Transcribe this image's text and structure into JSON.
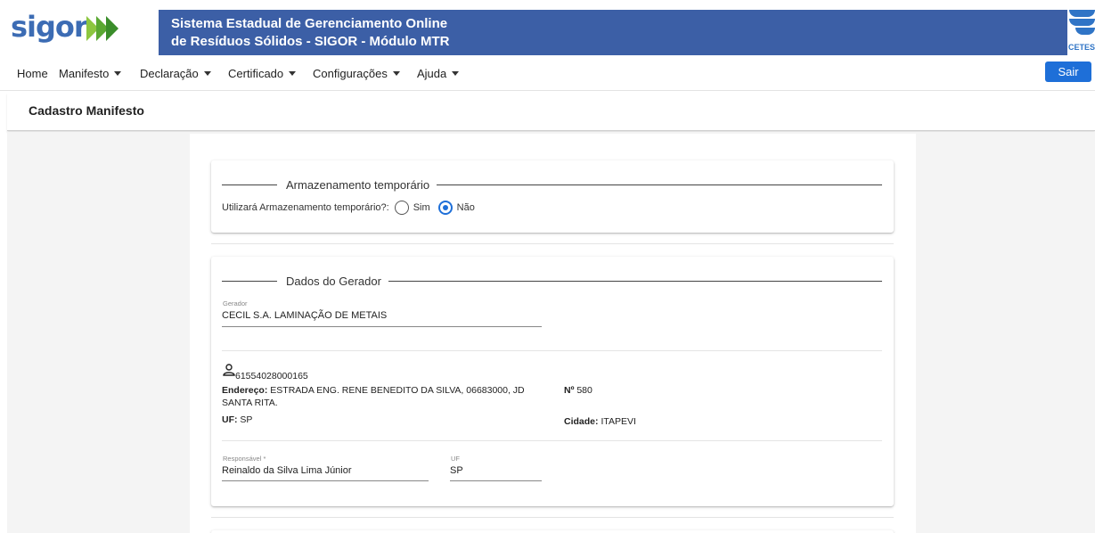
{
  "header": {
    "logo_text": "sigor",
    "title_line1": "Sistema Estadual de Gerenciamento Online",
    "title_line2": "de Resíduos Sólidos - SIGOR - Módulo MTR",
    "cetesb_label": "CETES",
    "brand_blue": "#3c5fa6",
    "accent_green": "#5aa832"
  },
  "nav": {
    "items": [
      {
        "label": "Home",
        "dropdown": false
      },
      {
        "label": "Manifesto",
        "dropdown": true
      },
      {
        "label": "Declaração",
        "dropdown": true
      },
      {
        "label": "Certificado",
        "dropdown": true
      },
      {
        "label": "Configurações",
        "dropdown": true
      },
      {
        "label": "Ajuda",
        "dropdown": true
      }
    ],
    "logout_label": "Sair"
  },
  "page": {
    "title": "Cadastro Manifesto"
  },
  "armazenamento": {
    "legend": "Armazenamento temporário",
    "question": "Utilizará Armazenamento temporário?:",
    "options": [
      "Sim",
      "Não"
    ],
    "selected": "Não"
  },
  "gerador": {
    "legend": "Dados do Gerador",
    "gerador_label": "Gerador",
    "gerador_value": "CECIL S.A. LAMINAÇÃO DE METAIS",
    "cnpj": "61554028000165",
    "endereco_label": "Endereço:",
    "endereco_value_line1": "ESTRADA ENG. RENE BENEDITO DA SILVA, 06683000, JD",
    "endereco_value_line2": "SANTA RITA.",
    "numero_label": "Nº",
    "numero_value": "580",
    "uf_label": "UF:",
    "uf_value": "SP",
    "cidade_label": "Cidade:",
    "cidade_value": "ITAPEVI",
    "responsavel_label": "Responsável *",
    "responsavel_value": "Reinaldo da Silva Lima Júnior",
    "uf_field_label": "UF",
    "uf_field_value": "SP"
  }
}
